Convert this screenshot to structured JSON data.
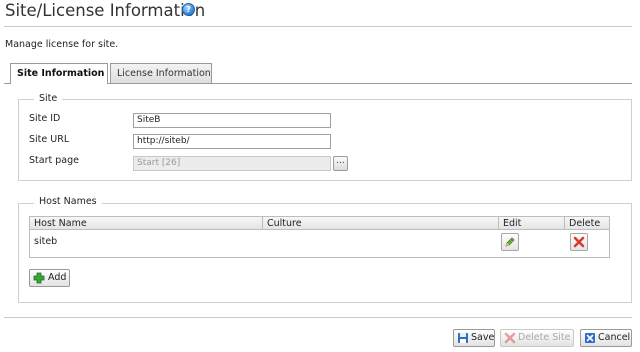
{
  "page": {
    "title": "Site/License Information",
    "description": "Manage license for site."
  },
  "tabs": [
    {
      "label": "Site Information",
      "active": true
    },
    {
      "label": "License Information",
      "active": false
    }
  ],
  "site_section": {
    "legend": "Site",
    "site_id_label": "Site ID",
    "site_id_value": "SiteB",
    "site_url_label": "Site URL",
    "site_url_value": "http://siteb/",
    "start_page_label": "Start page",
    "start_page_value": "Start [26]",
    "browse_label": "..."
  },
  "host_section": {
    "legend": "Host Names",
    "columns": [
      "Host Name",
      "Culture",
      "Edit",
      "Delete"
    ],
    "rows": [
      {
        "host_name": "siteb",
        "culture": ""
      }
    ],
    "add_label": "Add"
  },
  "footer": {
    "save_label": "Save",
    "delete_site_label": "Delete Site",
    "cancel_label": "Cancel"
  },
  "colors": {
    "accent_blue": "#2f7fd6",
    "add_green": "#3aa53a",
    "delete_red": "#d83a2e"
  }
}
